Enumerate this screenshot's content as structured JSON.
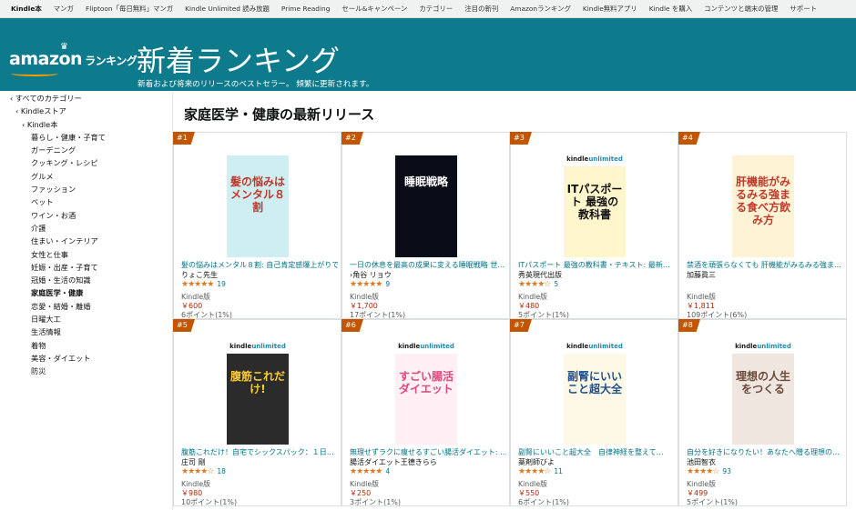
{
  "topnav": [
    "Kindle本",
    "マンガ",
    "Fliptoon「毎日無料」マンガ",
    "Kindle Unlimited 読み放題",
    "Prime Reading",
    "セール&キャンペーン",
    "カテゴリー",
    "注目の新刊",
    "Amazonランキング",
    "Kindle無料アプリ",
    "Kindle を購入",
    "コンテンツと端末の管理",
    "サポート"
  ],
  "logo": {
    "text": "amazon",
    "ranking": "ランキング"
  },
  "banner": {
    "title": "新着ランキング",
    "subtitle": "新着および将来のリリースのベストセラー。 頻繁に更新されます。"
  },
  "sidebar": [
    {
      "label": "‹ すべてのカテゴリー",
      "level": 0
    },
    {
      "label": "‹ Kindleストア",
      "level": 1
    },
    {
      "label": "‹ Kindle本",
      "level": 2
    },
    {
      "label": "暮らし・健康・子育て",
      "level": 3
    },
    {
      "label": "ガーデニング",
      "level": 3
    },
    {
      "label": "クッキング・レシピ",
      "level": 3
    },
    {
      "label": "グルメ",
      "level": 3
    },
    {
      "label": "ファッション",
      "level": 3
    },
    {
      "label": "ペット",
      "level": 3
    },
    {
      "label": "ワイン・お酒",
      "level": 3
    },
    {
      "label": "介護",
      "level": 3
    },
    {
      "label": "住まい・インテリア",
      "level": 3
    },
    {
      "label": "女性と仕事",
      "level": 3
    },
    {
      "label": "妊娠・出産・子育て",
      "level": 3
    },
    {
      "label": "冠婚・生活の知識",
      "level": 3
    },
    {
      "label": "家庭医学・健康",
      "level": 3,
      "selected": true
    },
    {
      "label": "恋愛・結婚・離婚",
      "level": 3
    },
    {
      "label": "日曜大工",
      "level": 3
    },
    {
      "label": "生活情報",
      "level": 3
    },
    {
      "label": "着物",
      "level": 3
    },
    {
      "label": "美容・ダイエット",
      "level": 3
    },
    {
      "label": "防災",
      "level": 3
    }
  ],
  "main": {
    "title": "家庭医学・健康の最新リリース"
  },
  "products": [
    {
      "rank": "#1",
      "name": "髪の悩みはメンタル８割: 自己肯定感爆上がりで…",
      "author": "りょこ先生",
      "stars": "★★★★★",
      "count": "19",
      "format": "Kindle版",
      "price": "￥600",
      "points": "6ポイント(1%)",
      "cover_bg": "#cfeef2",
      "cover_fg": "#c0392b",
      "cover_text": "髪の悩みはメンタル８割",
      "ku": false
    },
    {
      "rank": "#2",
      "name": "一日の休息を最高の成果に変える睡眠戦略 世…",
      "author": "›角谷 リョウ",
      "stars": "★★★★★",
      "count": "9",
      "format": "Kindle版",
      "price": "￥1,700",
      "points": "17ポイント(1%)",
      "cover_bg": "#0a0d18",
      "cover_fg": "#ffffff",
      "cover_text": "睡眠戦略",
      "ku": false
    },
    {
      "rank": "#3",
      "name": "ITパスポート 最強の教科書・テキスト: 最新…",
      "author": "秀英現代出版",
      "stars": "★★★★☆",
      "count": "5",
      "format": "Kindle版",
      "price": "￥480",
      "points": "5ポイント(1%)",
      "cover_bg": "#fff6cc",
      "cover_fg": "#111111",
      "cover_text": "ITパスポート 最強の教科書",
      "ku": true
    },
    {
      "rank": "#4",
      "name": "禁酒を頑張らなくても 肝機能がみるみる強ま…",
      "author": "加藤眞三",
      "stars": "",
      "count": "",
      "format": "Kindle版",
      "price": "￥1,811",
      "points": "109ポイント(6%)",
      "cover_bg": "#fff3d6",
      "cover_fg": "#c0392b",
      "cover_text": "肝機能がみるみる強まる食べ方飲み方",
      "ku": false
    },
    {
      "rank": "#5",
      "name": "腹筋これだけ！自宅でシックスパック：１日…",
      "author": "庄司 剛",
      "stars": "★★★★☆",
      "count": "18",
      "format": "Kindle版",
      "price": "￥980",
      "points": "10ポイント(1%)",
      "cover_bg": "#2b2b2b",
      "cover_fg": "#ffcc33",
      "cover_text": "腹筋これだけ!",
      "ku": true
    },
    {
      "rank": "#6",
      "name": "無理せずラクに痩せるすごい腸活ダイエット: …",
      "author": "腸活ダイエット王德きらら",
      "stars": "★★★★★",
      "count": "4",
      "format": "Kindle版",
      "price": "￥250",
      "points": "3ポイント(1%)",
      "cover_bg": "#fff0f5",
      "cover_fg": "#e0457b",
      "cover_text": "すごい腸活ダイエット",
      "ku": true
    },
    {
      "rank": "#7",
      "name": "副腎にいいこと超大全　自律神経を整えて…",
      "author": "薬剤師びよ",
      "stars": "★★★★☆",
      "count": "11",
      "format": "Kindle版",
      "price": "￥550",
      "points": "6ポイント(1%)",
      "cover_bg": "#fdf9e6",
      "cover_fg": "#1f4e8c",
      "cover_text": "副腎にいいこと超大全",
      "ku": true
    },
    {
      "rank": "#8",
      "name": "自分を好きになりたい！あなたへ贈る理想の…",
      "author": "池田智衣",
      "stars": "★★★★☆",
      "count": "93",
      "format": "Kindle版",
      "price": "￥499",
      "points": "5ポイント(1%)",
      "cover_bg": "#efe6e0",
      "cover_fg": "#6b4a3a",
      "cover_text": "理想の人生をつくる",
      "ku": true
    }
  ]
}
